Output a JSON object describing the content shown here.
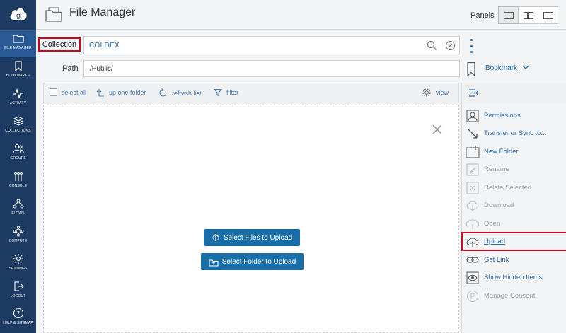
{
  "nav": {
    "items": [
      {
        "label": "FILE MANAGER",
        "icon": "folder-icon",
        "active": true
      },
      {
        "label": "BOOKMARKS",
        "icon": "bookmark-icon"
      },
      {
        "label": "ACTIVITY",
        "icon": "activity-icon"
      },
      {
        "label": "COLLECTIONS",
        "icon": "collections-icon"
      },
      {
        "label": "GROUPS",
        "icon": "groups-icon"
      },
      {
        "label": "CONSOLE",
        "icon": "console-icon"
      },
      {
        "label": "FLOWS",
        "icon": "flows-icon"
      },
      {
        "label": "COMPUTE",
        "icon": "compute-icon"
      },
      {
        "label": "SETTINGS",
        "icon": "settings-icon"
      },
      {
        "label": "LOGOUT",
        "icon": "logout-icon"
      },
      {
        "label": "HELP & SITEMAP",
        "icon": "help-icon"
      }
    ]
  },
  "header": {
    "title": "File Manager",
    "panels_label": "Panels"
  },
  "collection": {
    "label": "Collection",
    "value": "COLDEX"
  },
  "path": {
    "label": "Path",
    "value": "/Public/",
    "bookmark_label": "Bookmark"
  },
  "toolbar": {
    "select_all": "select all",
    "up_one_folder": "up one folder",
    "refresh_list": "refresh list",
    "filter": "filter",
    "view": "view"
  },
  "upload": {
    "select_files": "Select Files to Upload",
    "select_folder": "Select Folder to Upload"
  },
  "actions": [
    {
      "label": "Permissions",
      "enabled": true,
      "icon": "permissions-icon"
    },
    {
      "label": "Transfer or Sync to...",
      "enabled": true,
      "icon": "transfer-icon"
    },
    {
      "label": "New Folder",
      "enabled": true,
      "icon": "new-folder-icon"
    },
    {
      "label": "Rename",
      "enabled": false,
      "icon": "rename-icon"
    },
    {
      "label": "Delete Selected",
      "enabled": false,
      "icon": "delete-icon"
    },
    {
      "label": "Download",
      "enabled": false,
      "icon": "download-icon"
    },
    {
      "label": "Open",
      "enabled": false,
      "icon": "open-icon"
    },
    {
      "label": "Upload",
      "enabled": true,
      "highlighted": true,
      "icon": "upload-icon"
    },
    {
      "label": "Get Link",
      "enabled": true,
      "icon": "link-icon"
    },
    {
      "label": "Show Hidden Items",
      "enabled": true,
      "icon": "eye-icon"
    },
    {
      "label": "Manage Consent",
      "enabled": false,
      "icon": "consent-icon"
    }
  ],
  "colors": {
    "nav_bg": "#1c3a62",
    "nav_active": "#2a5a95",
    "accent": "#1d6fb8",
    "button_blue": "#1a6ea8",
    "highlight_red": "#d0021b"
  }
}
